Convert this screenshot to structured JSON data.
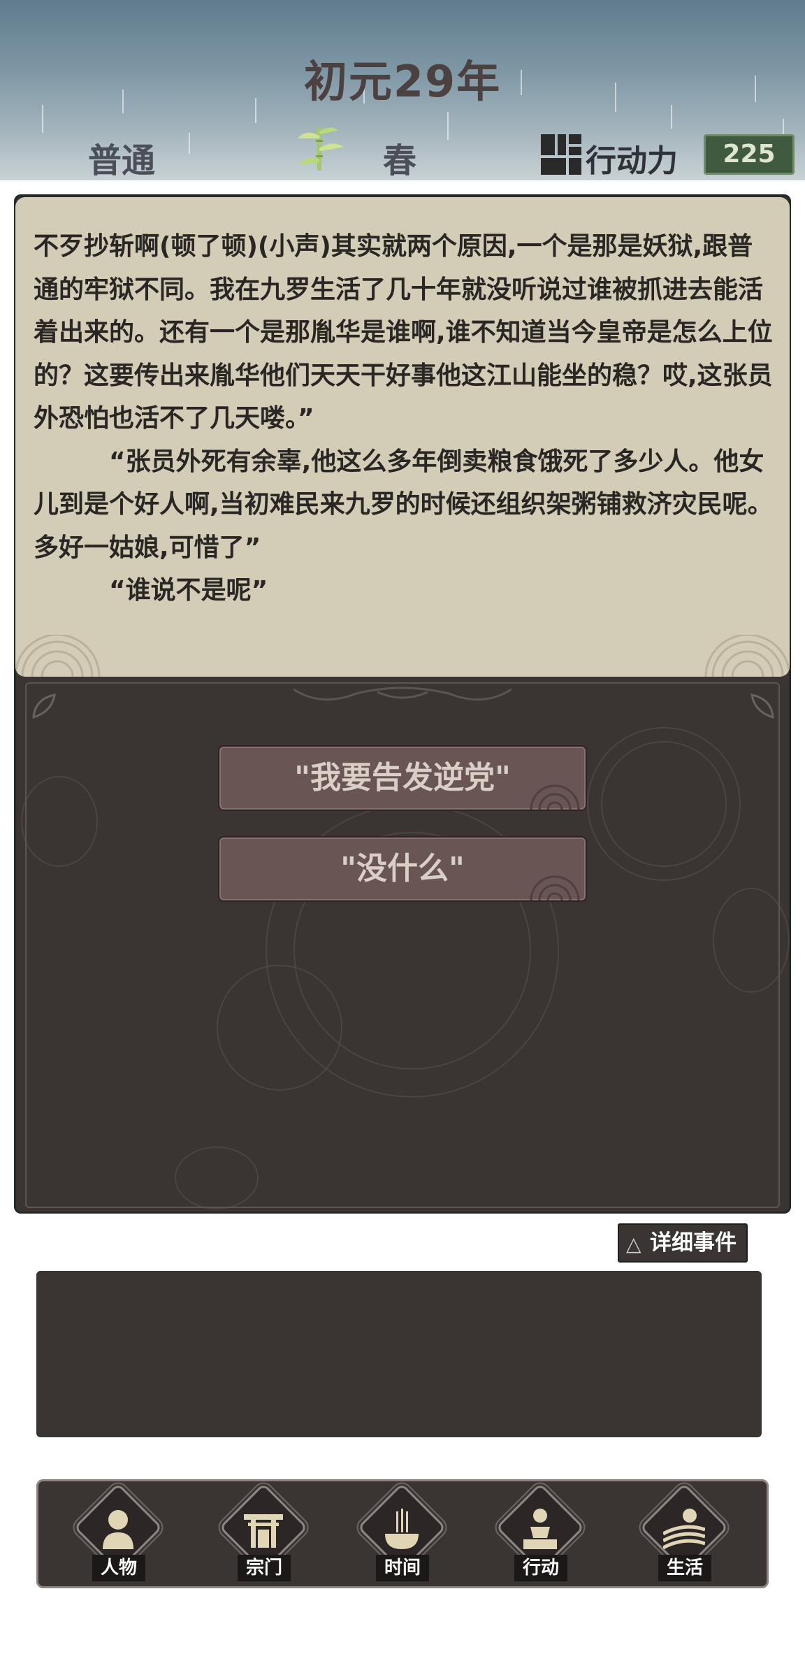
{
  "header": {
    "year_title": "初元29年",
    "difficulty": "普通",
    "season": "春",
    "action_points_label": "行动力",
    "action_points_value": "225"
  },
  "story": {
    "paragraphs": [
      "不歹抄斩啊(顿了顿)(小声)其实就两个原因,一个是那是妖狱,跟普通的牢狱不同。我在九罗生活了几十年就没听说过谁被抓进去能活着出来的。还有一个是那胤华是谁啊,谁不知道当今皇帝是怎么上位的？这要传出来胤华他们天天干好事他这江山能坐的稳？哎,这张员外恐怕也活不了几天喽。”",
      "“张员外死有余辜,他这么多年倒卖粮食饿死了多少人。他女儿到是个好人啊,当初难民来九罗的时候还组织架粥铺救济灾民呢。多好一姑娘,可惜了”",
      "“谁说不是呢”"
    ]
  },
  "choices": [
    {
      "label": "\"我要告发逆党\""
    },
    {
      "label": "\"没什么\""
    }
  ],
  "detail_events": {
    "icon": "triangle-icon",
    "label": "详细事件"
  },
  "nav": [
    {
      "label": "人物",
      "icon": "person-icon"
    },
    {
      "label": "宗门",
      "icon": "sect-gate-icon"
    },
    {
      "label": "时间",
      "icon": "incense-icon"
    },
    {
      "label": "行动",
      "icon": "action-icon"
    },
    {
      "label": "生活",
      "icon": "life-landscape-icon"
    }
  ]
}
